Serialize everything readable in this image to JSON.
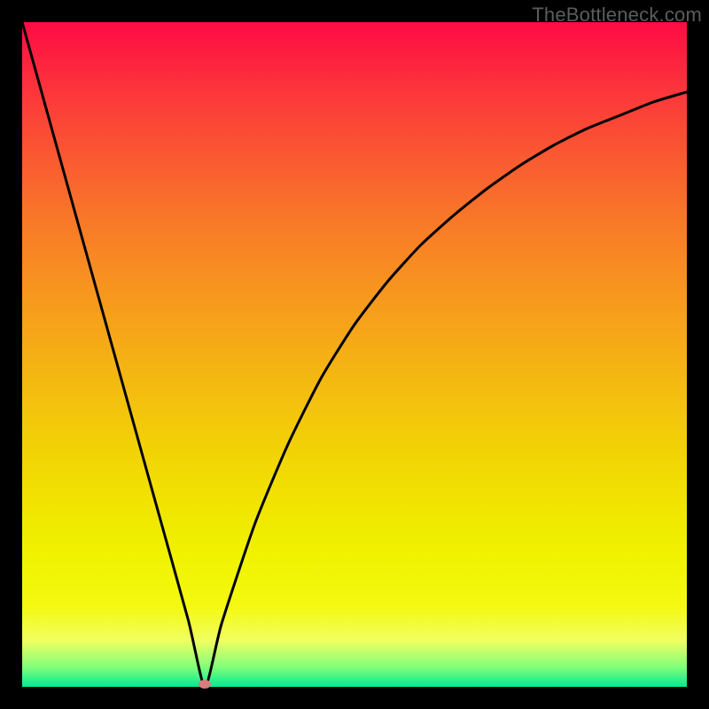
{
  "watermark": "TheBottleneck.com",
  "chart_data": {
    "type": "line",
    "title": "",
    "xlabel": "",
    "ylabel": "",
    "xlim": [
      0,
      100
    ],
    "ylim": [
      0,
      100
    ],
    "grid": false,
    "legend": false,
    "series": [
      {
        "name": "bottleneck-curve",
        "x": [
          0,
          5,
          10,
          15,
          20,
          25,
          27.5,
          30,
          35,
          40,
          45,
          50,
          55,
          60,
          65,
          70,
          75,
          80,
          85,
          90,
          95,
          100
        ],
        "values": [
          100,
          82,
          64,
          46,
          28,
          10,
          0,
          9.5,
          24.5,
          36.5,
          46.5,
          54.5,
          61.0,
          66.5,
          71.0,
          75.0,
          78.5,
          81.5,
          84.0,
          86.0,
          88.0,
          89.5
        ]
      }
    ],
    "minimum_point": {
      "x": 27.5,
      "y": 0
    },
    "background_gradient": {
      "top": "#fe0b44",
      "bottom": "#00ec92"
    },
    "marker_color": "#d77b7c"
  }
}
